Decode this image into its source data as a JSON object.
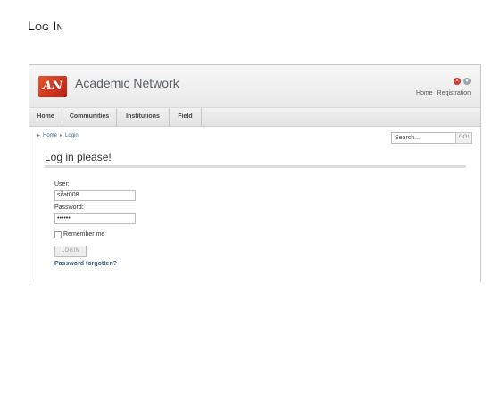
{
  "slide": {
    "title": "Log In"
  },
  "site": {
    "logo_text": "AN",
    "name": "Academic Network",
    "header_links": [
      "Home",
      "Registration"
    ],
    "icons": [
      "logout-icon",
      "globe-icon"
    ]
  },
  "nav": {
    "items": [
      "Home",
      "Communities",
      "Institutions",
      "Field"
    ]
  },
  "breadcrumb": {
    "items": [
      "Home",
      "Login"
    ]
  },
  "search": {
    "value": "Search...",
    "button": "GO!"
  },
  "login": {
    "heading": "Log in please!",
    "user_label": "User:",
    "user_value": "sifat008",
    "password_label": "Password:",
    "password_value": "••••••",
    "remember_label": "Remember me",
    "remember_checked": false,
    "submit": "LOGIN",
    "forgot": "Password forgotten?"
  },
  "colors": {
    "brand": "#c8321e",
    "link": "#3a6a92"
  }
}
